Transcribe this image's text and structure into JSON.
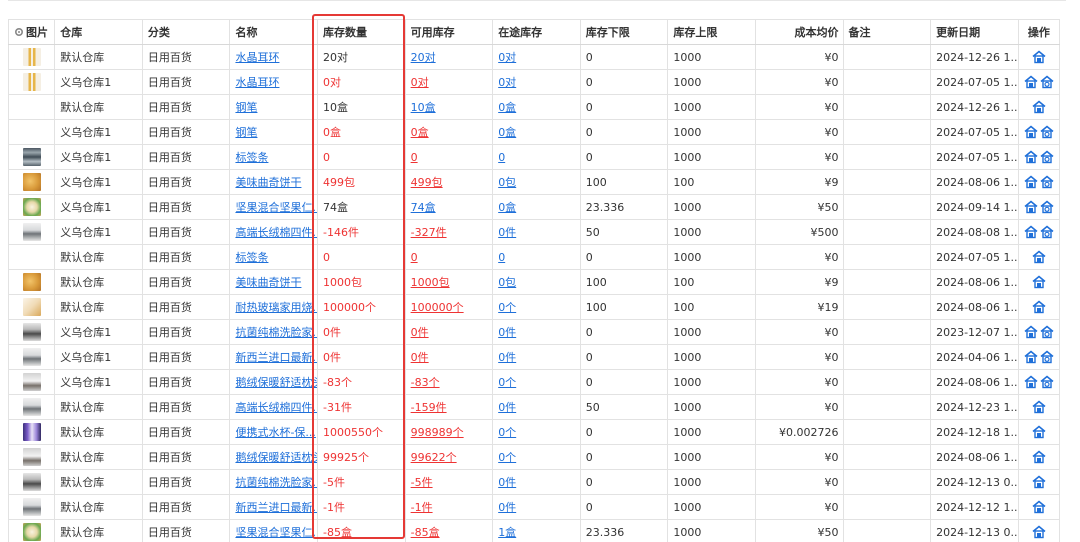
{
  "columns": {
    "image": "图片",
    "warehouse": "仓库",
    "category": "分类",
    "name": "名称",
    "stock_qty": "库存数量",
    "available": "可用库存",
    "in_transit": "在途库存",
    "min_stock": "库存下限",
    "max_stock": "库存上限",
    "avg_cost": "成本均价",
    "remark": "备注",
    "updated": "更新日期",
    "actions": "操作"
  },
  "icons": {
    "settings": "gear-icon",
    "warehouse_action": "warehouse-house-icon",
    "stock_action": "stock-transfer-icon"
  },
  "colors": {
    "link": "#1e6fd9",
    "negative": "#ee3333",
    "highlight_box": "#e53935",
    "action_icon": "#1e6fd9"
  },
  "rows": [
    {
      "thumb": "earring",
      "warehouse": "默认仓库",
      "category": "日用百货",
      "name": "水晶耳环",
      "stock_qty": "20对",
      "stock_neg": false,
      "available": "20对",
      "available_neg": false,
      "in_transit": "0对",
      "min_stock": "0",
      "max_stock": "1000",
      "avg_cost": "¥0",
      "remark": "",
      "updated": "2024-12-26 1...",
      "actions": 1
    },
    {
      "thumb": "earring",
      "warehouse": "义乌仓库1",
      "category": "日用百货",
      "name": "水晶耳环",
      "stock_qty": "0对",
      "stock_neg": true,
      "available": "0对",
      "available_neg": true,
      "in_transit": "0对",
      "min_stock": "0",
      "max_stock": "1000",
      "avg_cost": "¥0",
      "remark": "",
      "updated": "2024-07-05 1...",
      "actions": 2
    },
    {
      "thumb": "none",
      "warehouse": "默认仓库",
      "category": "日用百货",
      "name": "钢笔",
      "stock_qty": "10盒",
      "stock_neg": false,
      "available": "10盒",
      "available_neg": false,
      "in_transit": "0盒",
      "min_stock": "0",
      "max_stock": "1000",
      "avg_cost": "¥0",
      "remark": "",
      "updated": "2024-12-26 1...",
      "actions": 1
    },
    {
      "thumb": "none",
      "warehouse": "义乌仓库1",
      "category": "日用百货",
      "name": "钢笔",
      "stock_qty": "0盒",
      "stock_neg": true,
      "available": "0盒",
      "available_neg": true,
      "in_transit": "0盒",
      "min_stock": "0",
      "max_stock": "1000",
      "avg_cost": "¥0",
      "remark": "",
      "updated": "2024-07-05 1...",
      "actions": 2
    },
    {
      "thumb": "label",
      "warehouse": "义乌仓库1",
      "category": "日用百货",
      "name": "标签条",
      "stock_qty": "0",
      "stock_neg": true,
      "available": "0",
      "available_neg": true,
      "in_transit": "0",
      "min_stock": "0",
      "max_stock": "1000",
      "avg_cost": "¥0",
      "remark": "",
      "updated": "2024-07-05 1...",
      "actions": 2
    },
    {
      "thumb": "cookie",
      "warehouse": "义乌仓库1",
      "category": "日用百货",
      "name": "美味曲奇饼干",
      "stock_qty": "499包",
      "stock_neg": true,
      "available": "499包",
      "available_neg": true,
      "in_transit": "0包",
      "min_stock": "100",
      "max_stock": "100",
      "avg_cost": "¥9",
      "remark": "",
      "updated": "2024-08-06 1...",
      "actions": 2
    },
    {
      "thumb": "nuts",
      "warehouse": "义乌仓库1",
      "category": "日用百货",
      "name": "坚果混合坚果仁...",
      "stock_qty": "74盒",
      "stock_neg": false,
      "available": "74盒",
      "available_neg": false,
      "in_transit": "0盒",
      "min_stock": "23.336",
      "max_stock": "1000",
      "avg_cost": "¥50",
      "remark": "",
      "updated": "2024-09-14 1...",
      "actions": 2
    },
    {
      "thumb": "towel",
      "warehouse": "义乌仓库1",
      "category": "日用百货",
      "name": "高端长绒棉四件...",
      "stock_qty": "-146件",
      "stock_neg": true,
      "available": "-327件",
      "available_neg": true,
      "in_transit": "0件",
      "min_stock": "50",
      "max_stock": "1000",
      "avg_cost": "¥500",
      "remark": "",
      "updated": "2024-08-08 1...",
      "actions": 2
    },
    {
      "thumb": "none",
      "warehouse": "默认仓库",
      "category": "日用百货",
      "name": "标签条",
      "stock_qty": "0",
      "stock_neg": true,
      "available": "0",
      "available_neg": true,
      "in_transit": "0",
      "min_stock": "0",
      "max_stock": "1000",
      "avg_cost": "¥0",
      "remark": "",
      "updated": "2024-07-05 1...",
      "actions": 1
    },
    {
      "thumb": "cookie",
      "warehouse": "默认仓库",
      "category": "日用百货",
      "name": "美味曲奇饼干",
      "stock_qty": "1000包",
      "stock_neg": true,
      "available": "1000包",
      "available_neg": true,
      "in_transit": "0包",
      "min_stock": "100",
      "max_stock": "100",
      "avg_cost": "¥9",
      "remark": "",
      "updated": "2024-08-06 1...",
      "actions": 1
    },
    {
      "thumb": "glass",
      "warehouse": "默认仓库",
      "category": "日用百货",
      "name": "耐热玻璃家用烧...",
      "stock_qty": "100000个",
      "stock_neg": true,
      "available": "100000个",
      "available_neg": true,
      "in_transit": "0个",
      "min_stock": "100",
      "max_stock": "100",
      "avg_cost": "¥19",
      "remark": "",
      "updated": "2024-08-06 1...",
      "actions": 1
    },
    {
      "thumb": "tissue",
      "warehouse": "义乌仓库1",
      "category": "日用百货",
      "name": "抗菌纯棉洗脸家...",
      "stock_qty": "0件",
      "stock_neg": true,
      "available": "0件",
      "available_neg": true,
      "in_transit": "0件",
      "min_stock": "0",
      "max_stock": "1000",
      "avg_cost": "¥0",
      "remark": "",
      "updated": "2023-12-07 1...",
      "actions": 2
    },
    {
      "thumb": "towel",
      "warehouse": "义乌仓库1",
      "category": "日用百货",
      "name": "新西兰进口最新...",
      "stock_qty": "0件",
      "stock_neg": true,
      "available": "0件",
      "available_neg": true,
      "in_transit": "0件",
      "min_stock": "0",
      "max_stock": "1000",
      "avg_cost": "¥0",
      "remark": "",
      "updated": "2024-04-06 1...",
      "actions": 2
    },
    {
      "thumb": "pillow",
      "warehouse": "义乌仓库1",
      "category": "日用百货",
      "name": "鹅绒保暖舒适枕头",
      "stock_qty": "-83个",
      "stock_neg": true,
      "available": "-83个",
      "available_neg": true,
      "in_transit": "0个",
      "min_stock": "0",
      "max_stock": "1000",
      "avg_cost": "¥0",
      "remark": "",
      "updated": "2024-08-06 1...",
      "actions": 2
    },
    {
      "thumb": "towel",
      "warehouse": "默认仓库",
      "category": "日用百货",
      "name": "高端长绒棉四件...",
      "stock_qty": "-31件",
      "stock_neg": true,
      "available": "-159件",
      "available_neg": true,
      "in_transit": "0件",
      "min_stock": "50",
      "max_stock": "1000",
      "avg_cost": "¥0",
      "remark": "",
      "updated": "2024-12-23 1...",
      "actions": 1
    },
    {
      "thumb": "cup",
      "warehouse": "默认仓库",
      "category": "日用百货",
      "name": "便携式水杯-保...",
      "stock_qty": "1000550个",
      "stock_neg": true,
      "available": "998989个",
      "available_neg": true,
      "in_transit": "0个",
      "min_stock": "0",
      "max_stock": "1000",
      "avg_cost": "¥0.002726",
      "remark": "",
      "updated": "2024-12-18 1...",
      "actions": 1
    },
    {
      "thumb": "pillow",
      "warehouse": "默认仓库",
      "category": "日用百货",
      "name": "鹅绒保暖舒适枕头",
      "stock_qty": "99925个",
      "stock_neg": true,
      "available": "99622个",
      "available_neg": true,
      "in_transit": "0个",
      "min_stock": "0",
      "max_stock": "1000",
      "avg_cost": "¥0",
      "remark": "",
      "updated": "2024-08-06 1...",
      "actions": 1
    },
    {
      "thumb": "tissue",
      "warehouse": "默认仓库",
      "category": "日用百货",
      "name": "抗菌纯棉洗脸家...",
      "stock_qty": "-5件",
      "stock_neg": true,
      "available": "-5件",
      "available_neg": true,
      "in_transit": "0件",
      "min_stock": "0",
      "max_stock": "1000",
      "avg_cost": "¥0",
      "remark": "",
      "updated": "2024-12-13 0...",
      "actions": 1
    },
    {
      "thumb": "towel",
      "warehouse": "默认仓库",
      "category": "日用百货",
      "name": "新西兰进口最新...",
      "stock_qty": "-1件",
      "stock_neg": true,
      "available": "-1件",
      "available_neg": true,
      "in_transit": "0件",
      "min_stock": "0",
      "max_stock": "1000",
      "avg_cost": "¥0",
      "remark": "",
      "updated": "2024-12-12 1...",
      "actions": 1
    },
    {
      "thumb": "nuts",
      "warehouse": "默认仓库",
      "category": "日用百货",
      "name": "坚果混合坚果仁...",
      "stock_qty": "-85盒",
      "stock_neg": true,
      "available": "-85盒",
      "available_neg": true,
      "in_transit": "1盒",
      "min_stock": "23.336",
      "max_stock": "1000",
      "avg_cost": "¥50",
      "remark": "",
      "updated": "2024-12-13 0...",
      "actions": 1
    }
  ]
}
